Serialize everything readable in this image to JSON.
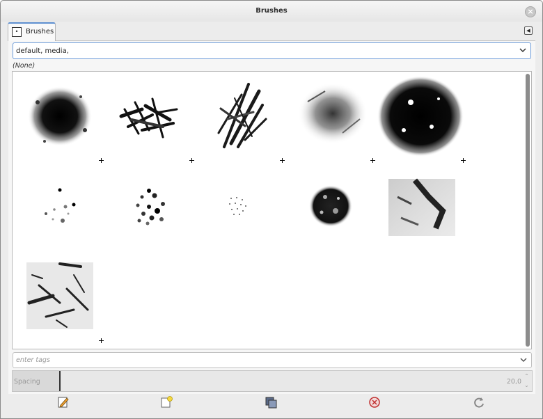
{
  "window": {
    "title": "Brushes"
  },
  "tab": {
    "label": "Brushes",
    "icon": "brush-dot-icon"
  },
  "filter": {
    "value": "default, media,"
  },
  "selected": {
    "name": "(None)"
  },
  "brushes": [
    {
      "row": 1,
      "col": 1,
      "icon": "brush-heavy-splatter",
      "has_plus": true
    },
    {
      "row": 1,
      "col": 2,
      "icon": "brush-chalk-strokes",
      "has_plus": true
    },
    {
      "row": 1,
      "col": 3,
      "icon": "brush-vertical-strokes",
      "has_plus": true
    },
    {
      "row": 1,
      "col": 4,
      "icon": "brush-soft-smudge",
      "has_plus": true
    },
    {
      "row": 1,
      "col": 5,
      "icon": "brush-grunge-blot",
      "has_plus": true
    },
    {
      "row": 2,
      "col": 1,
      "icon": "brush-scattered-dots",
      "has_plus": false
    },
    {
      "row": 2,
      "col": 2,
      "icon": "brush-blobs",
      "has_plus": false
    },
    {
      "row": 2,
      "col": 3,
      "icon": "brush-tiny-dots",
      "has_plus": false
    },
    {
      "row": 2,
      "col": 4,
      "icon": "brush-sponge",
      "has_plus": false
    },
    {
      "row": 2,
      "col": 5,
      "icon": "brush-texture-patch",
      "has_plus": false
    },
    {
      "row": 3,
      "col": 1,
      "icon": "brush-square-grunge",
      "has_plus": true
    }
  ],
  "tags": {
    "placeholder": "enter tags"
  },
  "spacing": {
    "label": "Spacing",
    "value": "20,0",
    "level_percent": 9
  },
  "buttons": [
    {
      "name": "edit-brush-button",
      "icon": "edit-icon"
    },
    {
      "name": "new-brush-button",
      "icon": "new-document-icon"
    },
    {
      "name": "duplicate-brush-button",
      "icon": "duplicate-icon"
    },
    {
      "name": "delete-brush-button",
      "icon": "delete-icon"
    },
    {
      "name": "refresh-brushes-button",
      "icon": "refresh-icon"
    }
  ]
}
